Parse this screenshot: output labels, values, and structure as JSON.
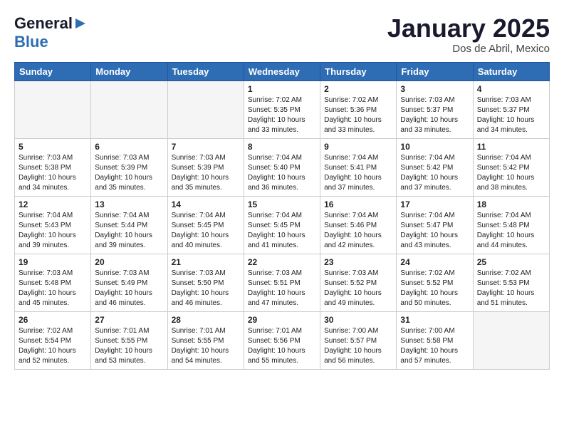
{
  "logo": {
    "line1": "General",
    "line2": "Blue",
    "icon": "▶"
  },
  "title": "January 2025",
  "subtitle": "Dos de Abril, Mexico",
  "days_of_week": [
    "Sunday",
    "Monday",
    "Tuesday",
    "Wednesday",
    "Thursday",
    "Friday",
    "Saturday"
  ],
  "weeks": [
    [
      {
        "day": "",
        "info": ""
      },
      {
        "day": "",
        "info": ""
      },
      {
        "day": "",
        "info": ""
      },
      {
        "day": "1",
        "info": "Sunrise: 7:02 AM\nSunset: 5:35 PM\nDaylight: 10 hours\nand 33 minutes."
      },
      {
        "day": "2",
        "info": "Sunrise: 7:02 AM\nSunset: 5:36 PM\nDaylight: 10 hours\nand 33 minutes."
      },
      {
        "day": "3",
        "info": "Sunrise: 7:03 AM\nSunset: 5:37 PM\nDaylight: 10 hours\nand 33 minutes."
      },
      {
        "day": "4",
        "info": "Sunrise: 7:03 AM\nSunset: 5:37 PM\nDaylight: 10 hours\nand 34 minutes."
      }
    ],
    [
      {
        "day": "5",
        "info": "Sunrise: 7:03 AM\nSunset: 5:38 PM\nDaylight: 10 hours\nand 34 minutes."
      },
      {
        "day": "6",
        "info": "Sunrise: 7:03 AM\nSunset: 5:39 PM\nDaylight: 10 hours\nand 35 minutes."
      },
      {
        "day": "7",
        "info": "Sunrise: 7:03 AM\nSunset: 5:39 PM\nDaylight: 10 hours\nand 35 minutes."
      },
      {
        "day": "8",
        "info": "Sunrise: 7:04 AM\nSunset: 5:40 PM\nDaylight: 10 hours\nand 36 minutes."
      },
      {
        "day": "9",
        "info": "Sunrise: 7:04 AM\nSunset: 5:41 PM\nDaylight: 10 hours\nand 37 minutes."
      },
      {
        "day": "10",
        "info": "Sunrise: 7:04 AM\nSunset: 5:42 PM\nDaylight: 10 hours\nand 37 minutes."
      },
      {
        "day": "11",
        "info": "Sunrise: 7:04 AM\nSunset: 5:42 PM\nDaylight: 10 hours\nand 38 minutes."
      }
    ],
    [
      {
        "day": "12",
        "info": "Sunrise: 7:04 AM\nSunset: 5:43 PM\nDaylight: 10 hours\nand 39 minutes."
      },
      {
        "day": "13",
        "info": "Sunrise: 7:04 AM\nSunset: 5:44 PM\nDaylight: 10 hours\nand 39 minutes."
      },
      {
        "day": "14",
        "info": "Sunrise: 7:04 AM\nSunset: 5:45 PM\nDaylight: 10 hours\nand 40 minutes."
      },
      {
        "day": "15",
        "info": "Sunrise: 7:04 AM\nSunset: 5:45 PM\nDaylight: 10 hours\nand 41 minutes."
      },
      {
        "day": "16",
        "info": "Sunrise: 7:04 AM\nSunset: 5:46 PM\nDaylight: 10 hours\nand 42 minutes."
      },
      {
        "day": "17",
        "info": "Sunrise: 7:04 AM\nSunset: 5:47 PM\nDaylight: 10 hours\nand 43 minutes."
      },
      {
        "day": "18",
        "info": "Sunrise: 7:04 AM\nSunset: 5:48 PM\nDaylight: 10 hours\nand 44 minutes."
      }
    ],
    [
      {
        "day": "19",
        "info": "Sunrise: 7:03 AM\nSunset: 5:48 PM\nDaylight: 10 hours\nand 45 minutes."
      },
      {
        "day": "20",
        "info": "Sunrise: 7:03 AM\nSunset: 5:49 PM\nDaylight: 10 hours\nand 46 minutes."
      },
      {
        "day": "21",
        "info": "Sunrise: 7:03 AM\nSunset: 5:50 PM\nDaylight: 10 hours\nand 46 minutes."
      },
      {
        "day": "22",
        "info": "Sunrise: 7:03 AM\nSunset: 5:51 PM\nDaylight: 10 hours\nand 47 minutes."
      },
      {
        "day": "23",
        "info": "Sunrise: 7:03 AM\nSunset: 5:52 PM\nDaylight: 10 hours\nand 49 minutes."
      },
      {
        "day": "24",
        "info": "Sunrise: 7:02 AM\nSunset: 5:52 PM\nDaylight: 10 hours\nand 50 minutes."
      },
      {
        "day": "25",
        "info": "Sunrise: 7:02 AM\nSunset: 5:53 PM\nDaylight: 10 hours\nand 51 minutes."
      }
    ],
    [
      {
        "day": "26",
        "info": "Sunrise: 7:02 AM\nSunset: 5:54 PM\nDaylight: 10 hours\nand 52 minutes."
      },
      {
        "day": "27",
        "info": "Sunrise: 7:01 AM\nSunset: 5:55 PM\nDaylight: 10 hours\nand 53 minutes."
      },
      {
        "day": "28",
        "info": "Sunrise: 7:01 AM\nSunset: 5:55 PM\nDaylight: 10 hours\nand 54 minutes."
      },
      {
        "day": "29",
        "info": "Sunrise: 7:01 AM\nSunset: 5:56 PM\nDaylight: 10 hours\nand 55 minutes."
      },
      {
        "day": "30",
        "info": "Sunrise: 7:00 AM\nSunset: 5:57 PM\nDaylight: 10 hours\nand 56 minutes."
      },
      {
        "day": "31",
        "info": "Sunrise: 7:00 AM\nSunset: 5:58 PM\nDaylight: 10 hours\nand 57 minutes."
      },
      {
        "day": "",
        "info": ""
      }
    ]
  ]
}
